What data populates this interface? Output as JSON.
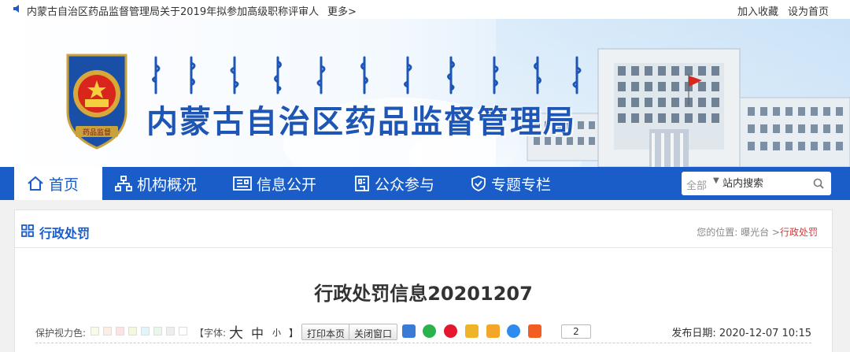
{
  "topbar": {
    "notice": "内蒙古自治区药品监督管理局关于2019年拟参加高级职称评审人",
    "more": "更多>",
    "add_favorite": "加入收藏",
    "set_homepage": "设为首页"
  },
  "banner": {
    "site_title": "内蒙古自治区药品监督管理局",
    "emblem_text": "药品监督"
  },
  "nav": {
    "items": [
      {
        "label": "首页",
        "icon": "home-icon"
      },
      {
        "label": "机构概况",
        "icon": "org-chart-icon"
      },
      {
        "label": "信息公开",
        "icon": "newspaper-icon"
      },
      {
        "label": "公众参与",
        "icon": "building-icon"
      },
      {
        "label": "专题专栏",
        "icon": "shield-icon"
      }
    ],
    "active_index": 0,
    "accent": "#1a5cc8"
  },
  "search": {
    "scope": "全部",
    "placeholder": "站内搜索"
  },
  "section": {
    "title": "行政处罚",
    "breadcrumb_prefix": "您的位置: ",
    "breadcrumb_parent": "曝光台",
    "breadcrumb_sep": " >",
    "breadcrumb_current": "行政处罚"
  },
  "article": {
    "title": "行政处罚信息20201207",
    "eye_protect_label": "保护视力色:",
    "eye_colors": [
      "#fafae8",
      "#fbeee4",
      "#fbe4e4",
      "#f2f9e0",
      "#e2f5fa",
      "#e8f7ea",
      "#eeeeee",
      "#ffffff"
    ],
    "font_label": "【字体:",
    "font_large": "大",
    "font_medium": "中",
    "font_small": "小",
    "font_end": "】",
    "print_button": "打印本页",
    "close_button": "关闭窗口",
    "share_count": "2",
    "publish_date": "发布日期: 2020-12-07 10:15"
  }
}
